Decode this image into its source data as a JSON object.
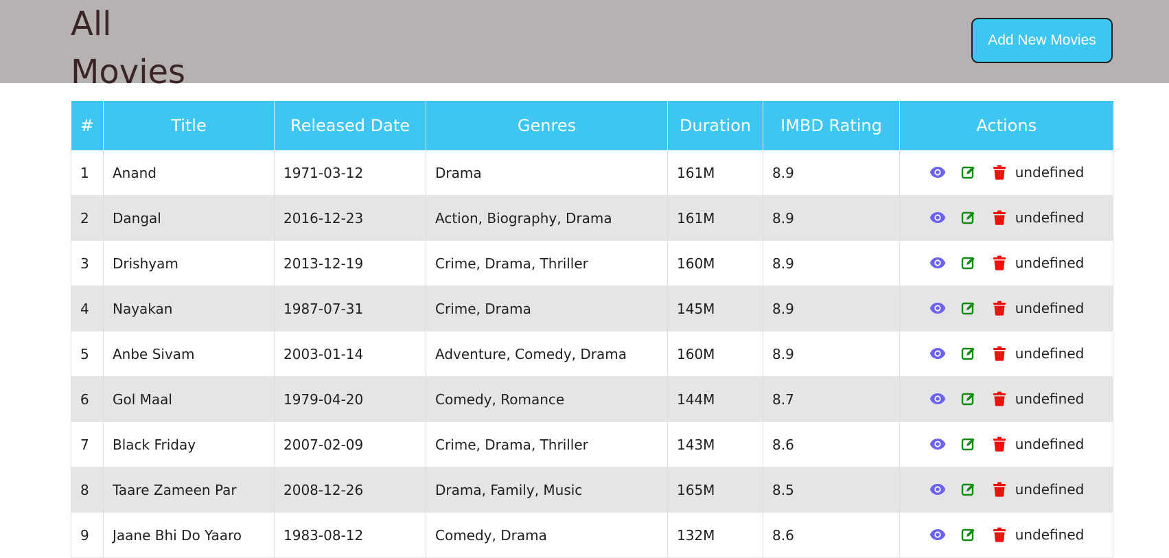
{
  "header": {
    "title": "All Movies",
    "add_button_label": "Add New Movies"
  },
  "table": {
    "columns": [
      "#",
      "Title",
      "Released Date",
      "Genres",
      "Duration",
      "IMBD Rating",
      "Actions"
    ],
    "rows": [
      {
        "num": "1",
        "title": "Anand",
        "date": "1971-03-12",
        "genres": "Drama",
        "duration": "161M",
        "rating": "8.9",
        "extra": "undefined"
      },
      {
        "num": "2",
        "title": "Dangal",
        "date": "2016-12-23",
        "genres": "Action, Biography, Drama",
        "duration": "161M",
        "rating": "8.9",
        "extra": "undefined"
      },
      {
        "num": "3",
        "title": "Drishyam",
        "date": "2013-12-19",
        "genres": "Crime, Drama, Thriller",
        "duration": "160M",
        "rating": "8.9",
        "extra": "undefined"
      },
      {
        "num": "4",
        "title": "Nayakan",
        "date": "1987-07-31",
        "genres": "Crime, Drama",
        "duration": "145M",
        "rating": "8.9",
        "extra": "undefined"
      },
      {
        "num": "5",
        "title": "Anbe Sivam",
        "date": "2003-01-14",
        "genres": "Adventure, Comedy, Drama",
        "duration": "160M",
        "rating": "8.9",
        "extra": "undefined"
      },
      {
        "num": "6",
        "title": "Gol Maal",
        "date": "1979-04-20",
        "genres": "Comedy, Romance",
        "duration": "144M",
        "rating": "8.7",
        "extra": "undefined"
      },
      {
        "num": "7",
        "title": "Black Friday",
        "date": "2007-02-09",
        "genres": "Crime, Drama, Thriller",
        "duration": "143M",
        "rating": "8.6",
        "extra": "undefined"
      },
      {
        "num": "8",
        "title": "Taare Zameen Par",
        "date": "2008-12-26",
        "genres": "Drama, Family, Music",
        "duration": "165M",
        "rating": "8.5",
        "extra": "undefined"
      },
      {
        "num": "9",
        "title": "Jaane Bhi Do Yaaro",
        "date": "1983-08-12",
        "genres": "Comedy, Drama",
        "duration": "132M",
        "rating": "8.6",
        "extra": "undefined"
      }
    ]
  },
  "icons": {
    "view": "eye-icon",
    "edit": "edit-icon",
    "delete": "trash-icon"
  },
  "colors": {
    "header_bar": "#b6b2b1",
    "accent": "#3ec6f3",
    "view_icon": "#6b63f0",
    "edit_icon": "#128a12",
    "delete_icon": "#f01010",
    "stripe": "#e5e5e5"
  }
}
